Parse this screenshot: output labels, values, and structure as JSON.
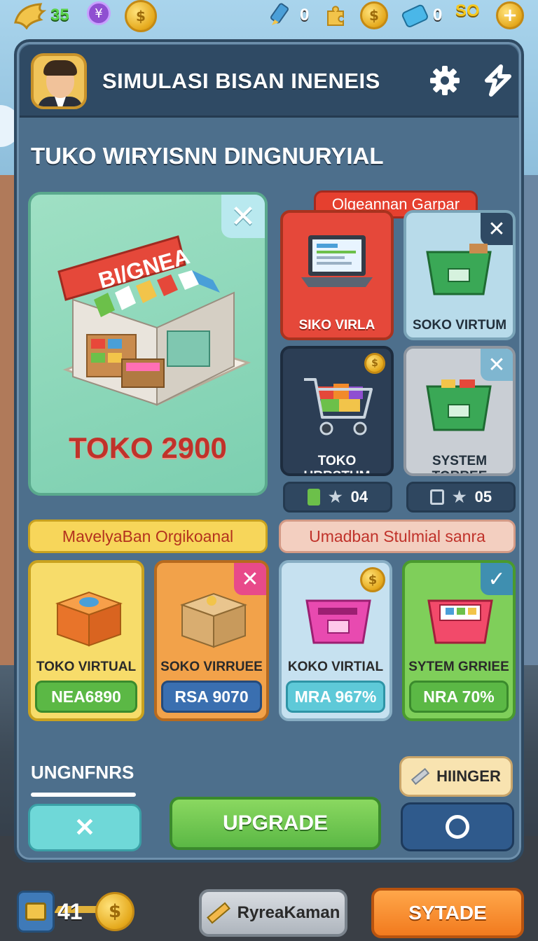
{
  "hud": {
    "energy_value": "35",
    "gem_symbol": "¥",
    "tool_value": "0",
    "ticket_value": "0",
    "money_value": "SO",
    "add_symbol": "+"
  },
  "header": {
    "title": "SIMULASI BISAN INENEIS"
  },
  "section_title": "TUKO WIRYISNN DINGNURYIAL",
  "featured": {
    "sign": "BI/GNEA",
    "price": "TOKO 2900"
  },
  "right_header_badge": "Olgeannan Garpar",
  "grid_cards": [
    {
      "label": "SIKO VIRLA"
    },
    {
      "label": "SOKO VIRTUM"
    },
    {
      "label": "TOKO URRSTUM"
    },
    {
      "label": "SYSTEM TORREE"
    }
  ],
  "stats": [
    {
      "value": "04"
    },
    {
      "value": "05"
    }
  ],
  "category_left": "MavelyaBan Orgikoanal",
  "category_right": "Umadban Stulmial sanra",
  "products": [
    {
      "label": "TOKO VIRTUAL",
      "price": "NEA6890"
    },
    {
      "label": "SOKO VIRRUEE",
      "price": "RSA 9070"
    },
    {
      "label": "KOKO VIRTIAL",
      "price": "MRA 967%"
    },
    {
      "label": "SYTEM GRRIEE",
      "price": "NRA 70%"
    }
  ],
  "bottom_panel": {
    "section_label": "UNGNFNRS",
    "upgrade_label": "UPGRADE",
    "hinger_label": "HIINGER"
  },
  "footer": {
    "count": "41",
    "middle_button": "RyreaKaman",
    "right_button": "SYTADE"
  },
  "colors": {
    "panel": "#4d6f8c",
    "accent_red": "#e5483a",
    "accent_green": "#6cc04a",
    "accent_orange": "#f28a2a"
  }
}
